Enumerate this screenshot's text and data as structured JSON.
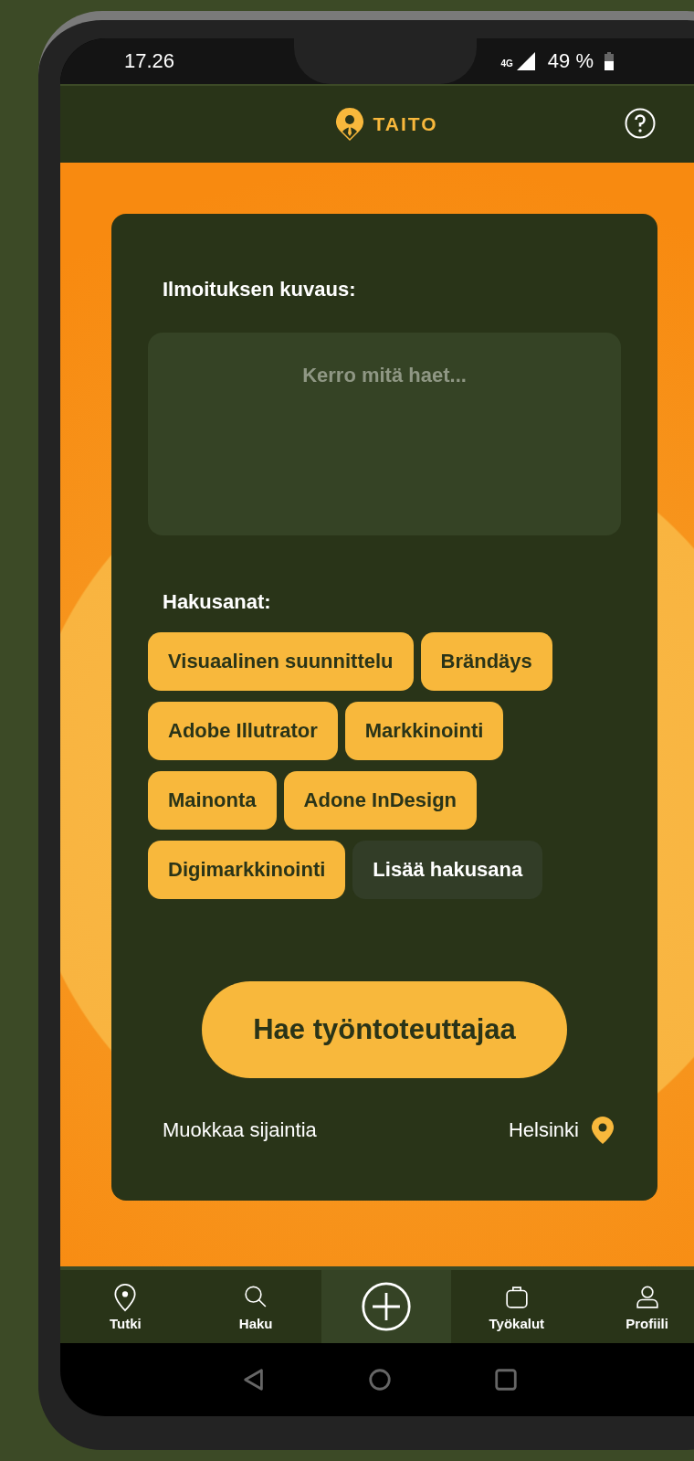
{
  "status_bar": {
    "time": "17.26",
    "network": "4G",
    "battery": "49 %"
  },
  "header": {
    "logo_text": "TAITO"
  },
  "form": {
    "description_label": "Ilmoituksen kuvaus:",
    "description_field": {
      "placeholder": "Kerro mitä haet..."
    },
    "keywords_label": "Hakusanat:",
    "keywords": [
      {
        "label": "Visuaalinen suunnittelu",
        "kind": "tag"
      },
      {
        "label": "Brändäys",
        "kind": "tag"
      },
      {
        "label": "Adobe Illutrator",
        "kind": "tag"
      },
      {
        "label": "Markkinointi",
        "kind": "tag"
      },
      {
        "label": "Mainonta",
        "kind": "tag"
      },
      {
        "label": "Adone InDesign",
        "kind": "tag"
      },
      {
        "label": "Digimarkkinointi",
        "kind": "tag"
      },
      {
        "label": "Lisää hakusana",
        "kind": "add"
      }
    ],
    "submit_button": "Hae työntoteuttajaa",
    "edit_location": "Muokkaa sijaintia",
    "location": "Helsinki"
  },
  "bottom_nav": [
    {
      "label": "Tutki",
      "kind": "explore",
      "selected": false
    },
    {
      "label": "Haku",
      "kind": "search",
      "selected": false
    },
    {
      "kind": "create",
      "selected": true
    },
    {
      "label": "Työkalut",
      "kind": "tools",
      "selected": false
    },
    {
      "label": "Profiili",
      "kind": "profile",
      "selected": false
    }
  ]
}
